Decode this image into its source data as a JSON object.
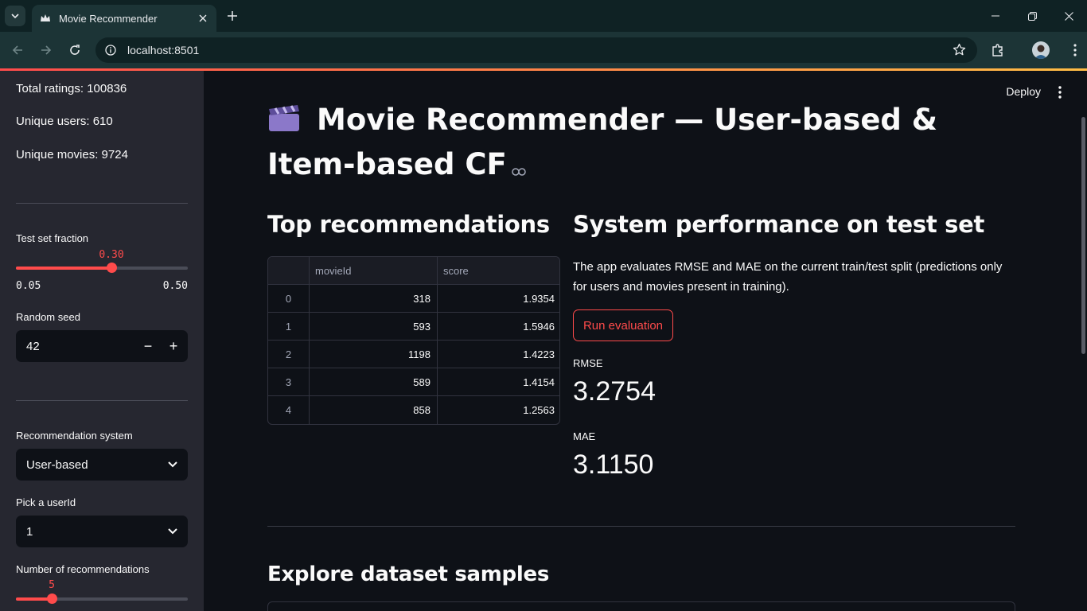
{
  "browser": {
    "tab_title": "Movie Recommender",
    "url": "localhost:8501"
  },
  "colors": {
    "accent": "#ff4b4b",
    "background": "#0e1117",
    "sidebar": "#262730",
    "chrome": "#1c3436"
  },
  "sidebar": {
    "total_ratings": "Total ratings: 100836",
    "unique_users": "Unique users: 610",
    "unique_movies": "Unique movies: 9724",
    "test_fraction": {
      "label": "Test set fraction",
      "value": "0.30",
      "min": "0.05",
      "max": "0.50",
      "level": 0.5556
    },
    "random_seed": {
      "label": "Random seed",
      "value": "42",
      "minus": "−",
      "plus": "+"
    },
    "rec_system": {
      "label": "Recommendation system",
      "value": "User-based"
    },
    "user_id": {
      "label": "Pick a userId",
      "value": "1"
    },
    "num_recs": {
      "label": "Number of recommendations",
      "value": "5",
      "level": 0.2105
    }
  },
  "header": {
    "deploy_label": "Deploy"
  },
  "main": {
    "title": "Movie Recommender — User-based & Item-based CF",
    "top_recs": {
      "heading": "Top recommendations",
      "columns": [
        "",
        "movieId",
        "score"
      ],
      "rows": [
        {
          "index": "0",
          "movieId": "318",
          "score": "1.9354"
        },
        {
          "index": "1",
          "movieId": "593",
          "score": "1.5946"
        },
        {
          "index": "2",
          "movieId": "1198",
          "score": "1.4223"
        },
        {
          "index": "3",
          "movieId": "589",
          "score": "1.4154"
        },
        {
          "index": "4",
          "movieId": "858",
          "score": "1.2563"
        }
      ]
    },
    "performance": {
      "heading": "System performance on test set",
      "description": "The app evaluates RMSE and MAE on the current train/test split (predictions only for users and movies present in training).",
      "button_label": "Run evaluation",
      "rmse_label": "RMSE",
      "rmse_value": "3.2754",
      "mae_label": "MAE",
      "mae_value": "3.1150"
    },
    "explore": {
      "heading": "Explore dataset samples"
    }
  }
}
